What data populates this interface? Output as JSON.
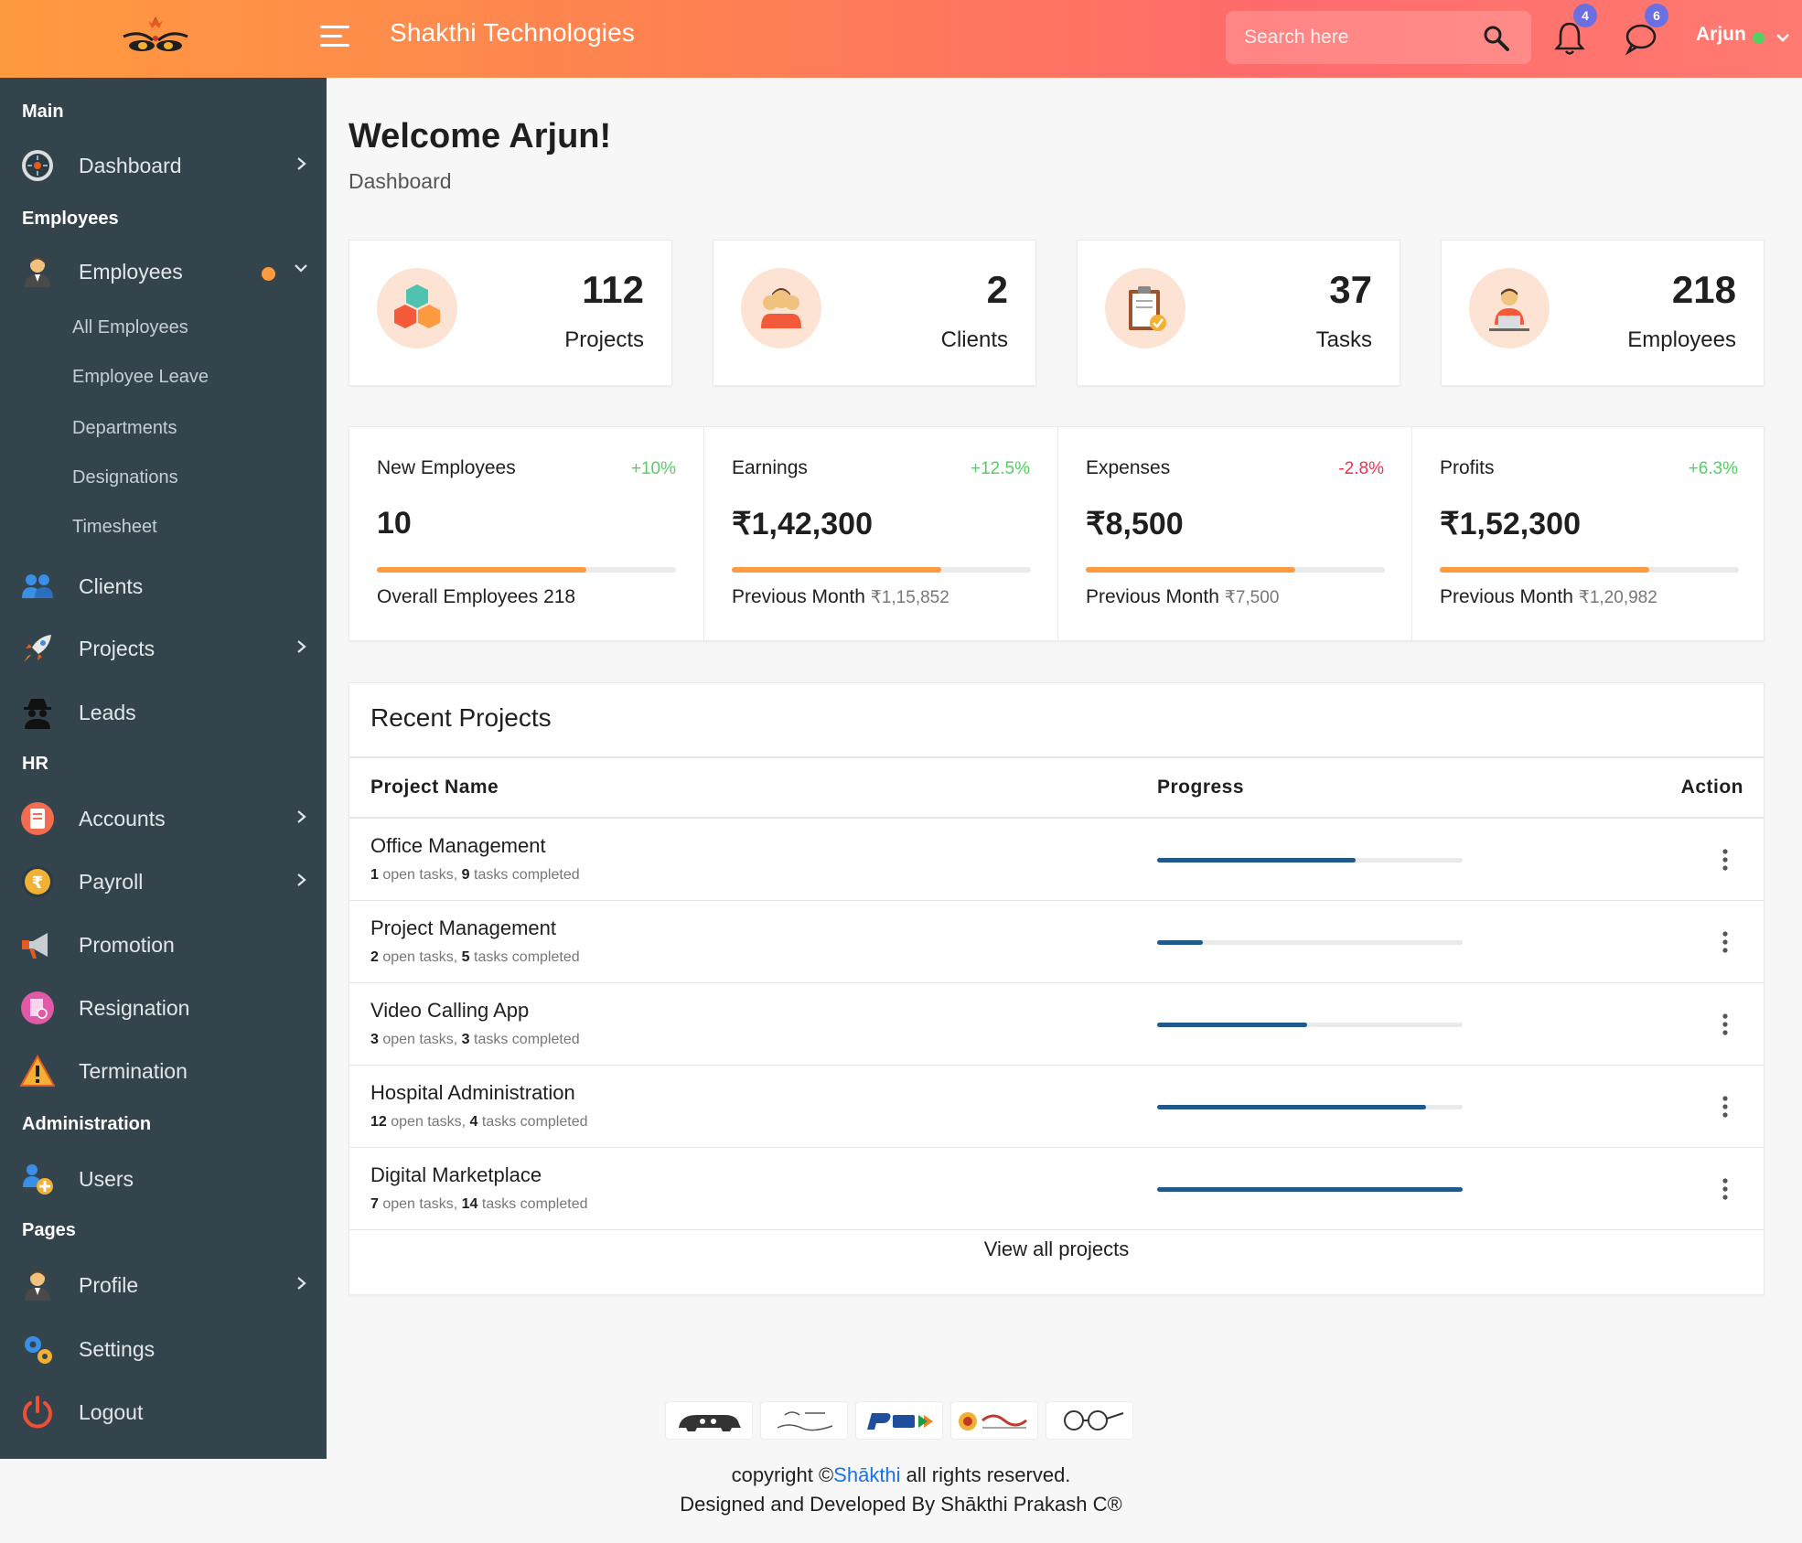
{
  "header": {
    "brand": "Shakthi Technologies",
    "search_placeholder": "Search here",
    "notifications_count": "4",
    "messages_count": "6",
    "user_name": "Arjun",
    "accent_gradient": [
      "#fe9a3f",
      "#ff6b6b"
    ]
  },
  "sidebar": {
    "sections": {
      "main": "Main",
      "employees": "Employees",
      "hr": "HR",
      "administration": "Administration",
      "pages": "Pages"
    },
    "items": {
      "dashboard": "Dashboard",
      "employees": "Employees",
      "clients": "Clients",
      "projects": "Projects",
      "leads": "Leads",
      "accounts": "Accounts",
      "payroll": "Payroll",
      "promotion": "Promotion",
      "resignation": "Resignation",
      "termination": "Termination",
      "users": "Users",
      "profile": "Profile",
      "settings": "Settings",
      "logout": "Logout"
    },
    "employee_sub": {
      "all": "All Employees",
      "leave": "Employee Leave",
      "departments": "Departments",
      "designations": "Designations",
      "timesheet": "Timesheet"
    }
  },
  "page": {
    "title": "Welcome Arjun!",
    "breadcrumb": "Dashboard"
  },
  "stats": [
    {
      "value": "112",
      "label": "Projects",
      "icon": "cubes-icon"
    },
    {
      "value": "2",
      "label": "Clients",
      "icon": "clients-icon"
    },
    {
      "value": "37",
      "label": "Tasks",
      "icon": "clipboard-icon"
    },
    {
      "value": "218",
      "label": "Employees",
      "icon": "employee-icon"
    }
  ],
  "metrics": [
    {
      "label": "New Employees",
      "change": "+10%",
      "value": "10",
      "foot_label": "Overall Employees 218",
      "foot_value": "",
      "progress": 0.7,
      "change_color": "#55ce63"
    },
    {
      "label": "Earnings",
      "change": "+12.5%",
      "value": "₹1,42,300",
      "foot_label": "Previous Month",
      "foot_value": "₹1,15,852",
      "progress": 0.7,
      "change_color": "#55ce63"
    },
    {
      "label": "Expenses",
      "change": "-2.8%",
      "value": "₹8,500",
      "foot_label": "Previous Month",
      "foot_value": "₹7,500",
      "progress": 0.7,
      "change_color": "#f62d51"
    },
    {
      "label": "Profits",
      "change": "+6.3%",
      "value": "₹1,52,300",
      "foot_label": "Previous Month",
      "foot_value": "₹1,20,982",
      "progress": 0.7,
      "change_color": "#55ce63"
    }
  ],
  "recent_projects": {
    "title": "Recent Projects",
    "columns": [
      "Project Name",
      "Progress",
      "Action"
    ],
    "open_tasks_label": "open tasks,",
    "completed_label": "tasks completed",
    "rows": [
      {
        "name": "Office Management",
        "open": "1",
        "completed": "9",
        "progress": 0.65
      },
      {
        "name": "Project Management",
        "open": "2",
        "completed": "5",
        "progress": 0.15
      },
      {
        "name": "Video Calling App",
        "open": "3",
        "completed": "3",
        "progress": 0.49
      },
      {
        "name": "Hospital Administration",
        "open": "12",
        "completed": "4",
        "progress": 0.88
      },
      {
        "name": "Digital Marketplace",
        "open": "7",
        "completed": "14",
        "progress": 1.0
      }
    ],
    "view_all": "View all projects"
  },
  "footer": {
    "copyright_prefix": "copyright ©",
    "copyright_brand": "Shākthi",
    "copyright_suffix": " all rights reserved.",
    "designed_by": "Designed and Developed By Shākthi Prakash C®",
    "partner_logos": [
      "Make in India",
      "Incredible India",
      "RuPay",
      "Karnataka Tourism",
      "Swachh Bharat"
    ]
  }
}
